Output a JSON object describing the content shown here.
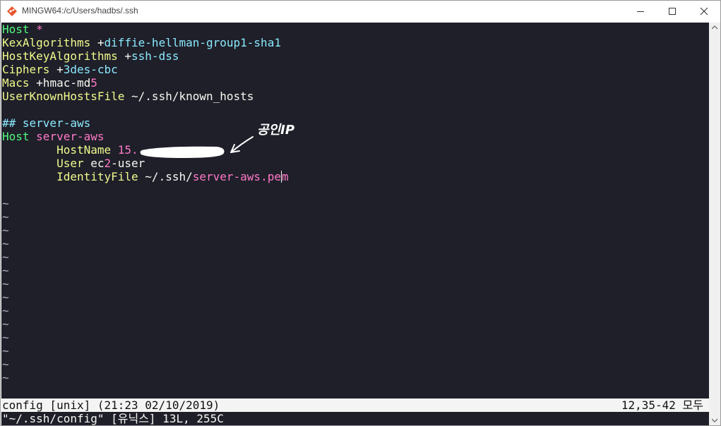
{
  "window": {
    "title": "MINGW64:/c/Users/hadbs/.ssh",
    "minimize_icon": "minimize-icon",
    "maximize_icon": "maximize-icon",
    "close_icon": "close-icon"
  },
  "editor": {
    "lines": [
      {
        "segments": [
          {
            "text": "Host ",
            "color": "green"
          },
          {
            "text": "*",
            "color": "pink"
          }
        ]
      },
      {
        "segments": [
          {
            "text": "KexAlgorithms ",
            "color": "yellow"
          },
          {
            "text": "+",
            "color": "white"
          },
          {
            "text": "diffie-hellman-group1-sha1",
            "color": "cyan"
          }
        ]
      },
      {
        "segments": [
          {
            "text": "HostKeyAlgorithms ",
            "color": "yellow"
          },
          {
            "text": "+",
            "color": "white"
          },
          {
            "text": "ssh-dss",
            "color": "cyan"
          }
        ]
      },
      {
        "segments": [
          {
            "text": "Ciphers ",
            "color": "yellow"
          },
          {
            "text": "+",
            "color": "white"
          },
          {
            "text": "3des-cbc",
            "color": "cyan"
          }
        ]
      },
      {
        "segments": [
          {
            "text": "Macs ",
            "color": "yellow"
          },
          {
            "text": "+hmac-md",
            "color": "white"
          },
          {
            "text": "5",
            "color": "pink"
          }
        ]
      },
      {
        "segments": [
          {
            "text": "UserKnownHostsFile ",
            "color": "yellow"
          },
          {
            "text": "~/.ssh/known_hosts",
            "color": "white"
          }
        ]
      },
      {
        "segments": []
      },
      {
        "segments": [
          {
            "text": "## server-aws",
            "color": "cyan"
          }
        ]
      },
      {
        "segments": [
          {
            "text": "Host ",
            "color": "green"
          },
          {
            "text": "server-aws",
            "color": "pink"
          }
        ]
      },
      {
        "segments": [
          {
            "text": "        HostName ",
            "color": "yellow"
          },
          {
            "text": "15.",
            "color": "pink"
          }
        ]
      },
      {
        "segments": [
          {
            "text": "        User ",
            "color": "yellow"
          },
          {
            "text": "ec",
            "color": "white"
          },
          {
            "text": "2",
            "color": "pink"
          },
          {
            "text": "-user",
            "color": "white"
          }
        ]
      },
      {
        "segments": [
          {
            "text": "        IdentityFile ",
            "color": "yellow"
          },
          {
            "text": "~/.ssh/",
            "color": "white"
          },
          {
            "text": "server-aws.pe",
            "color": "pink"
          },
          {
            "text": "m",
            "color": "pink",
            "cursor": true
          }
        ]
      },
      {
        "segments": []
      }
    ],
    "tilde": "~",
    "tilde_rows": 14
  },
  "statusline": {
    "left": "config [unix] (21:23 02/10/2019)",
    "right": "12,35-42 모두"
  },
  "cmdline": {
    "text": "\"~/.ssh/config\" [유닉스] 13L, 255C"
  },
  "annotation": {
    "label": "공인IP"
  }
}
